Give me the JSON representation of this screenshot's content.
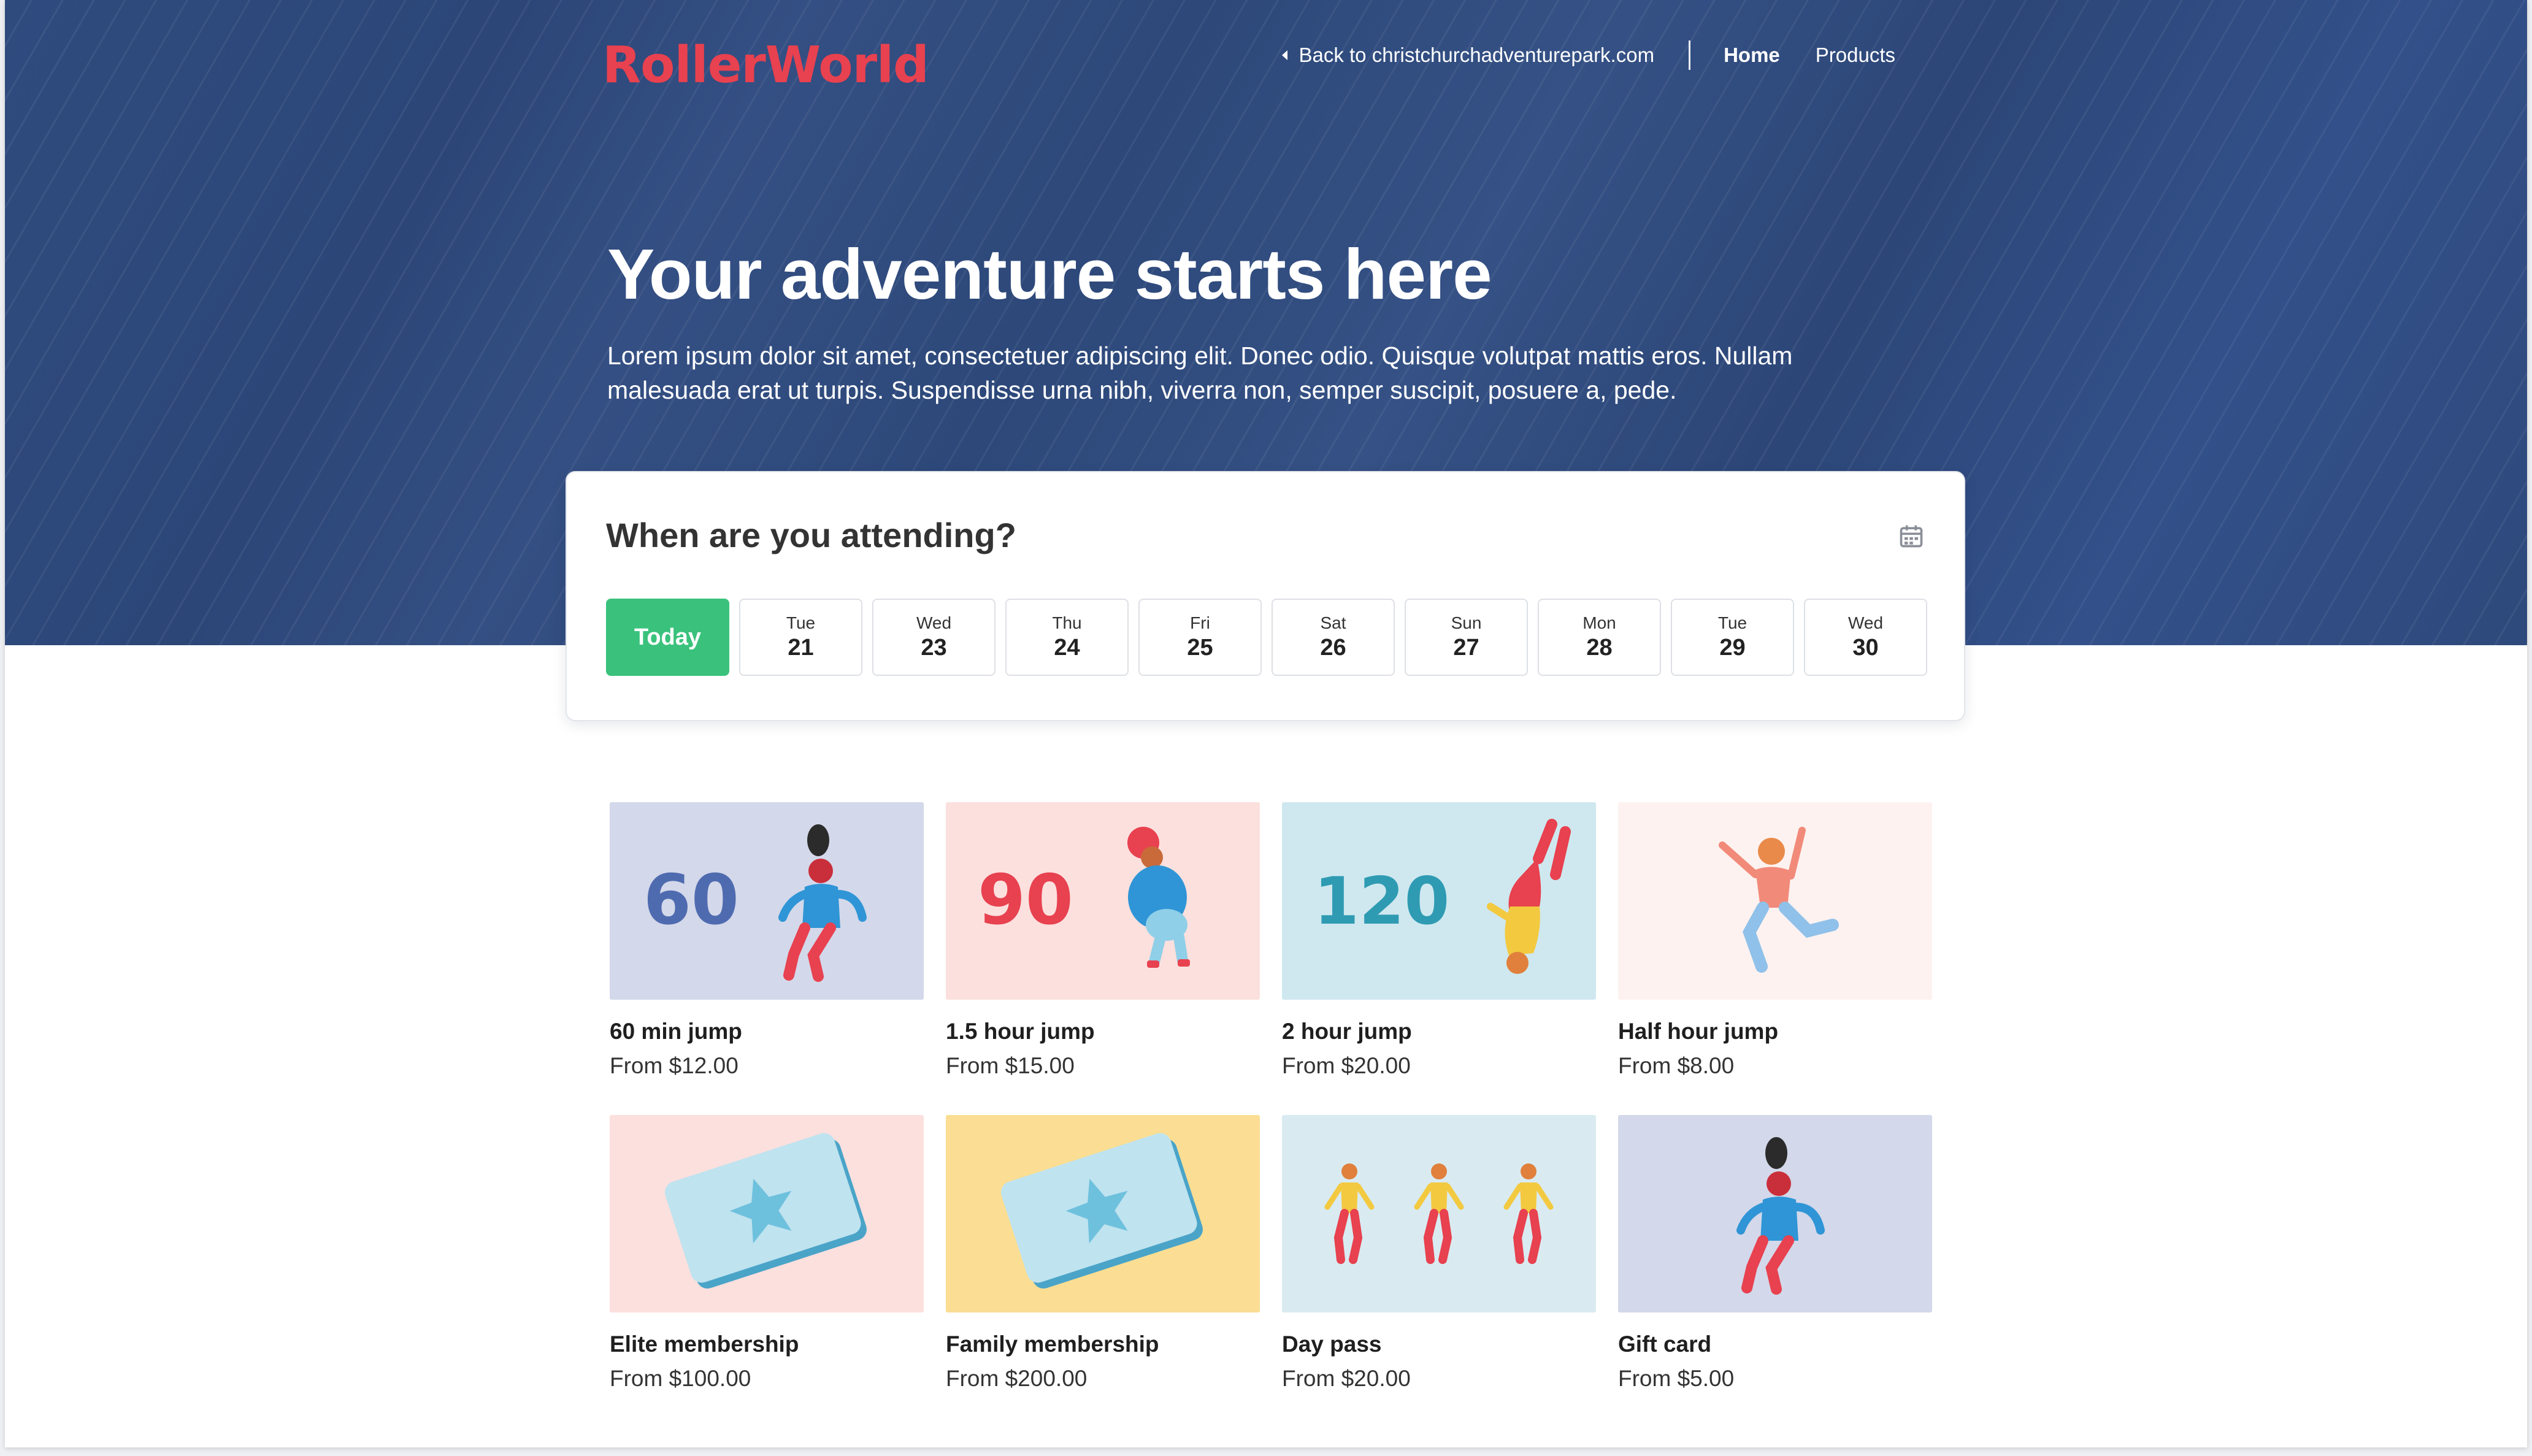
{
  "brand": {
    "logo_text": "RollerWorld",
    "logo_color": "#e8414f"
  },
  "nav": {
    "back_label": "Back to christchurchadventurepark.com",
    "items": [
      {
        "label": "Home",
        "active": true
      },
      {
        "label": "Products",
        "active": false
      }
    ]
  },
  "hero": {
    "title": "Your adventure starts here",
    "subtitle": "Lorem ipsum dolor sit amet, consectetuer adipiscing elit. Donec odio. Quisque volutpat mattis eros. Nullam malesuada erat ut turpis. Suspendisse urna nibh, viverra non, semper suscipit, posuere a, pede.",
    "background_color": "#2f4b7e"
  },
  "booking": {
    "heading": "When are you attending?",
    "calendar_icon": "calendar-icon",
    "today_label": "Today",
    "dates": [
      {
        "dow": "Tue",
        "day": "21"
      },
      {
        "dow": "Wed",
        "day": "23"
      },
      {
        "dow": "Thu",
        "day": "24"
      },
      {
        "dow": "Fri",
        "day": "25"
      },
      {
        "dow": "Sat",
        "day": "26"
      },
      {
        "dow": "Sun",
        "day": "27"
      },
      {
        "dow": "Mon",
        "day": "28"
      },
      {
        "dow": "Tue",
        "day": "29"
      },
      {
        "dow": "Wed",
        "day": "30"
      }
    ],
    "accent_color": "#3ac27c"
  },
  "products": [
    {
      "name": "60 min jump",
      "price": "From $12.00",
      "badge": "60",
      "bg": "#d3d8ea",
      "illustration": "jumper-60-illustration"
    },
    {
      "name": "1.5 hour jump",
      "price": "From $15.00",
      "badge": "90",
      "bg": "#fbe0de",
      "illustration": "jumper-90-illustration"
    },
    {
      "name": "2 hour jump",
      "price": "From $20.00",
      "badge": "120",
      "bg": "#cfe8ef",
      "illustration": "jumper-120-illustration"
    },
    {
      "name": "Half hour jump",
      "price": "From $8.00",
      "bg": "#fdf2ef",
      "illustration": "jumper-half-hour-illustration"
    },
    {
      "name": "Elite membership",
      "price": "From $100.00",
      "bg": "#fbe0de",
      "illustration": "membership-card-illustration"
    },
    {
      "name": "Family membership",
      "price": "From $200.00",
      "bg": "#fbde93",
      "illustration": "membership-card-illustration"
    },
    {
      "name": "Day pass",
      "price": "From $20.00",
      "bg": "#d9ebf1",
      "illustration": "three-people-illustration"
    },
    {
      "name": "Gift card",
      "price": "From $5.00",
      "bg": "#d3d8ea",
      "illustration": "jumper-gift-illustration"
    }
  ]
}
